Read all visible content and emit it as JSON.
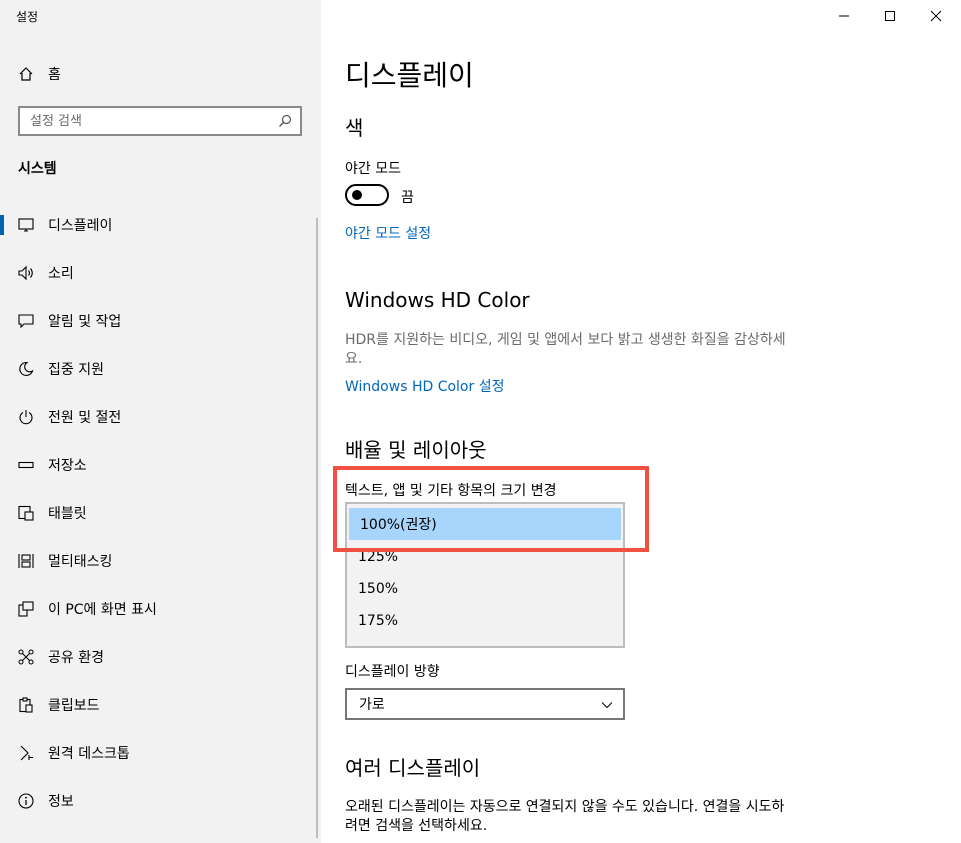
{
  "app": {
    "title": "설정"
  },
  "sidebar": {
    "home_label": "홈",
    "search_placeholder": "설정 검색",
    "section_title": "시스템",
    "items": [
      {
        "label": "디스플레이",
        "icon": "monitor-icon",
        "active": true
      },
      {
        "label": "소리",
        "icon": "speaker-icon"
      },
      {
        "label": "알림 및 작업",
        "icon": "notification-icon"
      },
      {
        "label": "집중 지원",
        "icon": "moon-icon"
      },
      {
        "label": "전원 및 절전",
        "icon": "power-icon"
      },
      {
        "label": "저장소",
        "icon": "storage-icon"
      },
      {
        "label": "태블릿",
        "icon": "tablet-icon"
      },
      {
        "label": "멀티태스킹",
        "icon": "multitasking-icon"
      },
      {
        "label": "이 PC에 화면 표시",
        "icon": "project-icon"
      },
      {
        "label": "공유 환경",
        "icon": "share-icon"
      },
      {
        "label": "클립보드",
        "icon": "clipboard-icon"
      },
      {
        "label": "원격 데스크톱",
        "icon": "remote-desktop-icon"
      },
      {
        "label": "정보",
        "icon": "info-icon"
      }
    ]
  },
  "main": {
    "page_title": "디스플레이",
    "color_section": {
      "title": "색",
      "night_mode_label": "야간 모드",
      "toggle_state": "끔",
      "night_mode_settings_link": "야간 모드 설정"
    },
    "hd_color": {
      "title": "Windows HD Color",
      "description": "HDR를 지원하는 비디오, 게임 및 앱에서 보다 밝고 생생한 화질을 감상하세요.",
      "link": "Windows HD Color 설정"
    },
    "scale_layout": {
      "title": "배율 및 레이아웃",
      "scale_label": "텍스트, 앱 및 기타 항목의 크기 변경",
      "options": [
        "100%(권장)",
        "125%",
        "150%",
        "175%"
      ],
      "selected_index": 0,
      "orientation_label": "디스플레이 방향",
      "orientation_value": "가로"
    },
    "multi_display": {
      "title": "여러 디스플레이",
      "description": "오래된 디스플레이는 자동으로 연결되지 않을 수도 있습니다. 연결을 시도하려면 검색을 선택하세요."
    }
  },
  "colors": {
    "sidebar_bg": "#f2f2f2",
    "accent": "#0063b1",
    "link": "#0067c0",
    "highlight": "#f05142",
    "selection": "#a8d5fb"
  }
}
